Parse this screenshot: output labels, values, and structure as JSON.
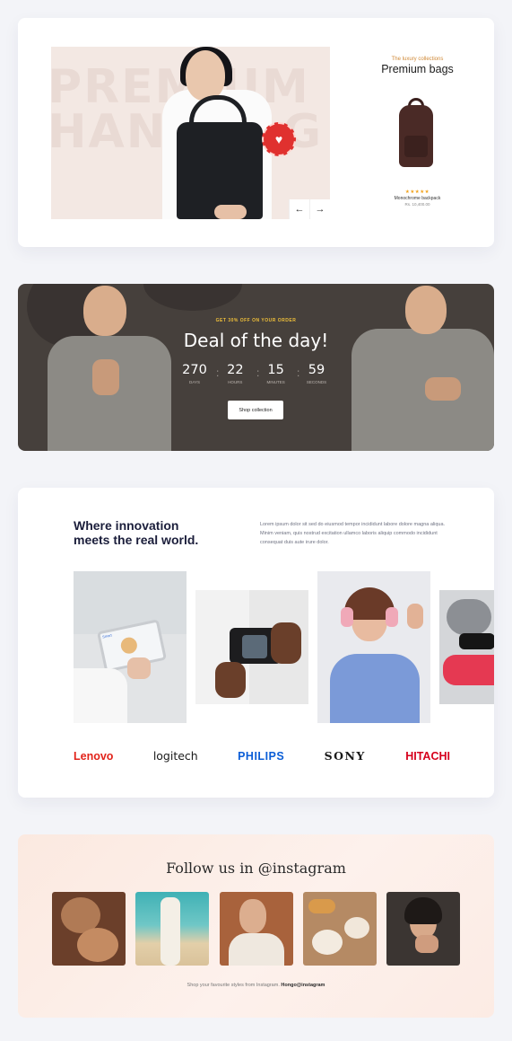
{
  "premium": {
    "hero_bg_text": "PREMIUM\nHANDBAG",
    "kicker": "The luxury collections",
    "title": "Premium bags",
    "product_rating": "★★★★★",
    "product_name": "Monochrome backpack",
    "product_price": "Rs. 10,400.00",
    "prev_label": "←",
    "next_label": "→"
  },
  "deal": {
    "kicker": "GET 30% OFF ON YOUR ORDER",
    "title": "Deal of the day!",
    "countdown": [
      {
        "value": "270",
        "label": "DAYS"
      },
      {
        "value": "22",
        "label": "HOURS"
      },
      {
        "value": "15",
        "label": "MINUTES"
      },
      {
        "value": "59",
        "label": "SECONDS"
      }
    ],
    "separator": ":",
    "button_label": "Shop collection"
  },
  "innovation": {
    "title_line1": "Where innovation",
    "title_line2": "meets the real world.",
    "description": "Lorem ipsum dolor sit sed do eiusmod tempor incididunt labore dolore magna aliqua. Minim veniam, quis nostrud excitation ullamco laboris aliquip commodo incididunt consequat duis aute irure dolor.",
    "tablet_label": "Smart",
    "brands": [
      {
        "name": "Lenovo",
        "color": "#e2231a"
      },
      {
        "name": "logitech",
        "color": "#1a1a1a"
      },
      {
        "name": "PHILIPS",
        "color": "#0b5ed7"
      },
      {
        "name": "SONY",
        "color": "#1a1a1a"
      },
      {
        "name": "HITACHI",
        "color": "#d6001c"
      }
    ]
  },
  "instagram": {
    "title": "Follow us in @instagram",
    "footer_text": "Shop your favourite styles from Instagram.",
    "footer_handle": "Hongo@instagram"
  }
}
